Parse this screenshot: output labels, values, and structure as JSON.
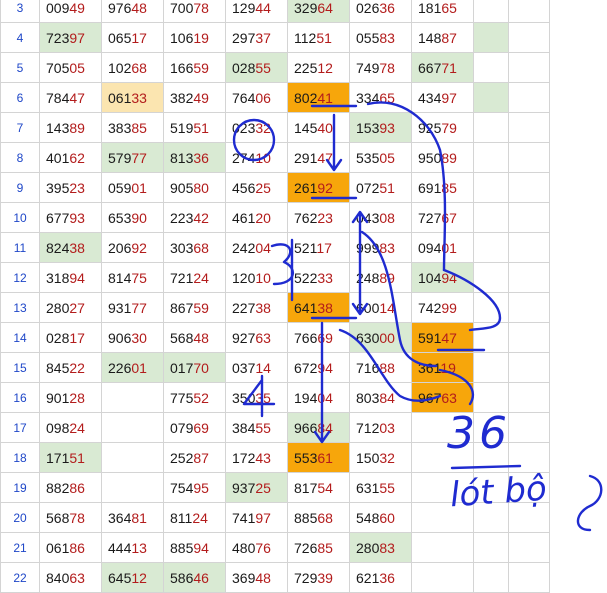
{
  "rows": [
    {
      "row": "3",
      "cells": [
        "00949",
        "97648",
        "70078",
        "12944",
        "32964",
        "02636",
        "18165"
      ],
      "hi": [
        [
          false,
          false
        ],
        [
          false,
          false
        ],
        [
          false,
          false
        ],
        [
          false,
          false
        ],
        [
          true,
          false
        ],
        [
          false,
          false
        ],
        [
          false,
          false
        ]
      ],
      "bg": [
        "",
        "",
        "",
        "",
        "g",
        "",
        "",
        ""
      ]
    },
    {
      "row": "4",
      "cells": [
        "72397",
        "06517",
        "10619",
        "29737",
        "11251",
        "05583",
        "14887"
      ],
      "bg": [
        "g",
        "",
        "",
        "",
        "",
        "",
        "",
        "g"
      ]
    },
    {
      "row": "5",
      "cells": [
        "70505",
        "10268",
        "16659",
        "02855",
        "22512",
        "74978",
        "66771"
      ],
      "bg": [
        "",
        "",
        "",
        "g",
        "",
        "",
        "g",
        ""
      ]
    },
    {
      "row": "6",
      "cells": [
        "78447",
        "06133",
        "38249",
        "76406",
        "80241",
        "33465",
        "43497"
      ],
      "bg": [
        "",
        "y",
        "",
        "",
        "o",
        "",
        "",
        "g"
      ]
    },
    {
      "row": "7",
      "cells": [
        "14389",
        "38385",
        "51951",
        "02332",
        "14540",
        "15393",
        "92579"
      ],
      "bg": [
        "",
        "",
        "",
        "",
        "",
        "g",
        "",
        ""
      ]
    },
    {
      "row": "8",
      "cells": [
        "40162",
        "57977",
        "81336",
        "27410",
        "29147",
        "53505",
        "95089"
      ],
      "bg": [
        "",
        "g",
        "g",
        "",
        "",
        "",
        "",
        ""
      ]
    },
    {
      "row": "9",
      "cells": [
        "39523",
        "05901",
        "90580",
        "45625",
        "26192",
        "07251",
        "69185"
      ],
      "bg": [
        "",
        "",
        "",
        "",
        "o",
        "",
        "",
        ""
      ]
    },
    {
      "row": "10",
      "cells": [
        "67793",
        "65390",
        "22342",
        "46120",
        "76223",
        "04308",
        "72767"
      ],
      "bg": [
        "",
        "",
        "",
        "",
        "",
        "",
        "",
        ""
      ]
    },
    {
      "row": "11",
      "cells": [
        "82438",
        "20692",
        "30368",
        "24204",
        "52117",
        "99983",
        "09401"
      ],
      "bg": [
        "g",
        "",
        "",
        "",
        "",
        "",
        "",
        ""
      ]
    },
    {
      "row": "12",
      "cells": [
        "31894",
        "81475",
        "72124",
        "12010",
        "52233",
        "24889",
        "10494"
      ],
      "bg": [
        "",
        "",
        "",
        "",
        "",
        "",
        "g",
        ""
      ]
    },
    {
      "row": "13",
      "cells": [
        "28027",
        "93177",
        "86759",
        "22738",
        "64138",
        "60014",
        "74299"
      ],
      "bg": [
        "",
        "",
        "",
        "",
        "o",
        "",
        "",
        ""
      ]
    },
    {
      "row": "14",
      "cells": [
        "02817",
        "90630",
        "56848",
        "92763",
        "76669",
        "63000",
        "59147"
      ],
      "bg": [
        "",
        "",
        "",
        "",
        "",
        "g",
        "o",
        ""
      ]
    },
    {
      "row": "15",
      "cells": [
        "84522",
        "22601",
        "01770",
        "03714",
        "67294",
        "71688",
        "36119"
      ],
      "bg": [
        "",
        "g",
        "g",
        "",
        "",
        "",
        "o",
        ""
      ]
    },
    {
      "row": "16",
      "cells": [
        "90128",
        "",
        "77552",
        "35035",
        "19404",
        "80384",
        "96763"
      ],
      "bg": [
        "",
        "",
        "",
        "",
        "",
        "",
        "o",
        ""
      ]
    },
    {
      "row": "17",
      "cells": [
        "09824",
        "",
        "07969",
        "38455",
        "96684",
        "71203",
        ""
      ],
      "bg": [
        "",
        "",
        "",
        "",
        "g",
        "",
        "",
        ""
      ]
    },
    {
      "row": "18",
      "cells": [
        "17151",
        "",
        "25287",
        "17243",
        "55361",
        "15032",
        ""
      ],
      "bg": [
        "g",
        "",
        "",
        "",
        "o",
        "",
        "",
        ""
      ]
    },
    {
      "row": "19",
      "cells": [
        "88286",
        "",
        "75495",
        "93725",
        "81754",
        "63155",
        ""
      ],
      "bg": [
        "",
        "",
        "",
        "g",
        "",
        "",
        "",
        ""
      ]
    },
    {
      "row": "20",
      "cells": [
        "56878",
        "36481",
        "81124",
        "74197",
        "88568",
        "54860",
        ""
      ],
      "bg": [
        "",
        "",
        "",
        "",
        "",
        "",
        "",
        ""
      ]
    },
    {
      "row": "21",
      "cells": [
        "06186",
        "44413",
        "88594",
        "48076",
        "72685",
        "28083",
        ""
      ],
      "bg": [
        "",
        "",
        "",
        "",
        "",
        "g",
        "",
        ""
      ]
    },
    {
      "row": "22",
      "cells": [
        "84063",
        "64512",
        "58646",
        "36948",
        "72939",
        "62136",
        ""
      ],
      "bg": [
        "",
        "g",
        "g",
        "",
        "",
        "",
        "",
        ""
      ]
    }
  ],
  "annotations": {
    "circled_number": "2",
    "mid_number": "3",
    "lower_number": "4",
    "big_number": "36",
    "note_text": "lót bộ"
  }
}
